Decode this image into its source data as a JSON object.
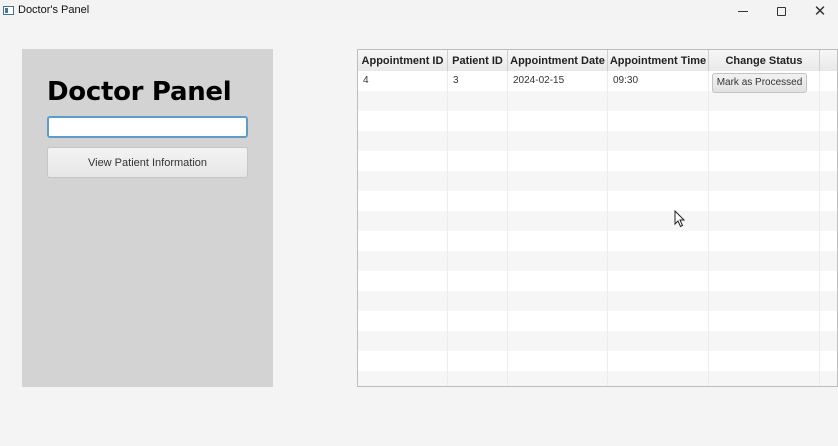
{
  "window": {
    "title": "Doctor's Panel",
    "controls": {
      "minimize": "minimize-icon",
      "maximize": "maximize-icon",
      "close": "close-icon"
    }
  },
  "left_panel": {
    "heading": "Doctor Panel",
    "patient_input": {
      "value": "",
      "placeholder": ""
    },
    "view_button_label": "View Patient Information"
  },
  "table": {
    "columns": [
      "Appointment ID",
      "Patient ID",
      "Appointment Date",
      "Appointment Time",
      "Change Status"
    ],
    "rows": [
      {
        "appointment_id": "4",
        "patient_id": "3",
        "date": "2024-02-15",
        "time": "09:30",
        "action_label": "Mark as Processed"
      }
    ],
    "empty_row_count": 15
  },
  "colors": {
    "panel_bg": "#d3d3d3",
    "window_bg": "#f4f4f4",
    "input_focus": "#5c9ec7"
  }
}
